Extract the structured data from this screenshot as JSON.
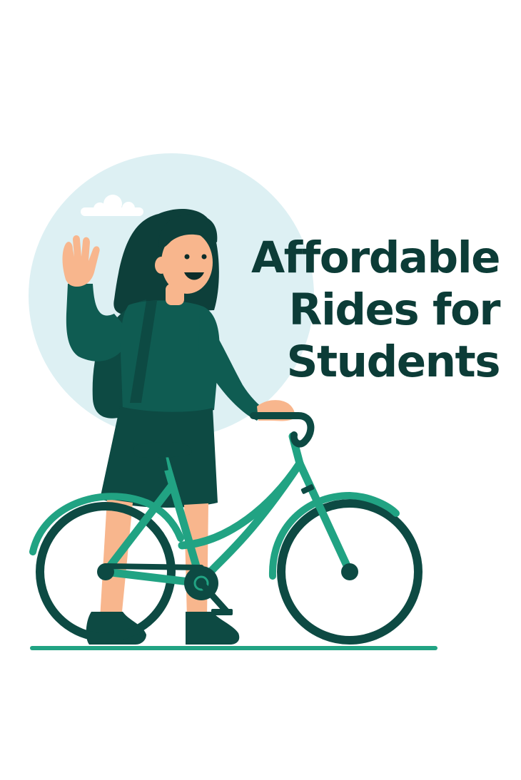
{
  "headline": {
    "line1": "Affordable",
    "line2": "Rides for",
    "line3": "Students"
  },
  "colors": {
    "headline_text": "#0c3c37",
    "sky_circle": "#ddf0f3",
    "cloud": "#ffffff",
    "bike_frame": "#21a383",
    "tire_and_clothing": "#0d4a43",
    "shirt": "#0f5c52",
    "hair": "#0d3f3a",
    "skin": "#f8b68d",
    "ground_line": "#21a383"
  },
  "icons": {
    "main_illustration": "student-waving-with-bicycle",
    "cloud": "cloud-icon",
    "bicycle": "bicycle-icon"
  }
}
